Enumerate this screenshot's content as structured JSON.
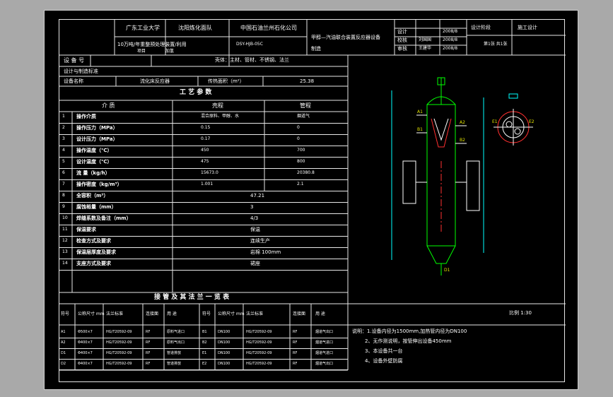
{
  "title_block": {
    "university": "广东工业大学",
    "department": "沈阳炼化面队",
    "company": "中国石油兰州石化公司",
    "project_line": "10万吨/年重整预处理装置/利用",
    "drawing_no": "DSY-HJB-05C",
    "item_label": "项目",
    "item_value": "加氢",
    "drawing_title": "甲醇—汽油联合装置反应器设备",
    "drawing_title_suffix": "制造",
    "sign_rows": [
      {
        "role": "设计",
        "name": "",
        "date": "2008/8"
      },
      {
        "role": "校核",
        "name": "刘国国",
        "date": "2008/8"
      },
      {
        "role": "审核",
        "name": "王建华",
        "date": "2008/8"
      }
    ],
    "stage_label": "设计阶段",
    "stage_value": "施工设计",
    "sheet_info": "第1张  共1张"
  },
  "design_table": {
    "equipment_label": "设 备 号",
    "type_row": "设计与制造标准",
    "equipment_name_label": "设备名称",
    "equipment_name": "流化床反应器",
    "area_label": "传热面积（m²）",
    "area_value": "25.38",
    "materials": "壳体：主材、管材、不锈钢、法兰",
    "section_title": "工 艺 参 数",
    "col_medium": "介 质",
    "col_shell": "壳程",
    "col_tube": "管程",
    "rows": [
      {
        "no": "1",
        "name": "操作介质",
        "shell": "混合原料、甲醇、水",
        "tube": "烟道气"
      },
      {
        "no": "2",
        "name": "操作压力（MPa）",
        "shell": "0.15",
        "tube": "0"
      },
      {
        "no": "3",
        "name": "设计压力（MPa）",
        "shell": "0.17",
        "tube": "0"
      },
      {
        "no": "4",
        "name": "操作温度（℃）",
        "shell": "450",
        "tube": "700"
      },
      {
        "no": "5",
        "name": "设计温度（℃）",
        "shell": "475",
        "tube": "800"
      },
      {
        "no": "6",
        "name": "流 量（kg/h）",
        "shell": "15673.0",
        "tube": "20380.8"
      },
      {
        "no": "7",
        "name": "操作密度（kg/m³）",
        "shell": "1.001",
        "tube": "2.1"
      },
      {
        "no": "8",
        "name": "全容积（m³）",
        "merged": "47.21"
      },
      {
        "no": "9",
        "name": "腐蚀裕量（mm）",
        "merged": "3"
      },
      {
        "no": "10",
        "name": "焊缝系数及备注（mm）",
        "merged": "4/3"
      },
      {
        "no": "11",
        "name": "保温要求",
        "merged": "保温"
      },
      {
        "no": "12",
        "name": "检查方式及要求",
        "merged": "连续生产"
      },
      {
        "no": "13",
        "name": "保温层厚度及要求",
        "merged": "岩棉 100mm"
      },
      {
        "no": "14",
        "name": "支座方式及要求",
        "merged": "裙座"
      }
    ]
  },
  "nozzle_table": {
    "title": "接 管 及 其 法 兰 一 览 表",
    "headers": [
      "符号",
      "公称尺寸 mm",
      "法兰标准",
      "连接面",
      "用 途",
      "符号",
      "公称尺寸 mm",
      "法兰标准",
      "连接面",
      "用 途"
    ],
    "rows": [
      [
        "A1",
        "Φ500×7",
        "HG/T20592-09",
        "RF",
        "原料气进口",
        "B1",
        "DN100",
        "HG/T20592-09",
        "RF",
        "烟道气出口"
      ],
      [
        "A2",
        "Φ400×7",
        "HG/T20592-09",
        "RF",
        "原料气出口",
        "B2",
        "DN100",
        "HG/T20592-09",
        "RF",
        "烟道气进口"
      ],
      [
        "D1",
        "Φ400×7",
        "HG/T20592-09",
        "RF",
        "管道排放",
        "E1",
        "DN100",
        "HG/T20592-09",
        "RF",
        "烟道气进口"
      ],
      [
        "D2",
        "Φ400×7",
        "HG/T20592-09",
        "RF",
        "管道排放",
        "E2",
        "DN100",
        "HG/T20592-09",
        "RF",
        "烟道气出口"
      ]
    ]
  },
  "notes": {
    "scale": "比例 1:30",
    "lines": [
      "说明：1.设备内径为1500mm,加热管内径为DN100",
      "2、无作测说明，按管伸出设备450mm",
      "3、本设备共一台",
      "4、设备外壁防腐"
    ]
  },
  "drawing": {
    "colors": {
      "outline": "#ffffff",
      "vessel": "#00ff00",
      "accent": "#ff3030",
      "dims": "#00ffff",
      "text": "#ffff00"
    },
    "labels": [
      "A1",
      "A2",
      "B1",
      "B2",
      "D1",
      "E1",
      "E2"
    ]
  }
}
